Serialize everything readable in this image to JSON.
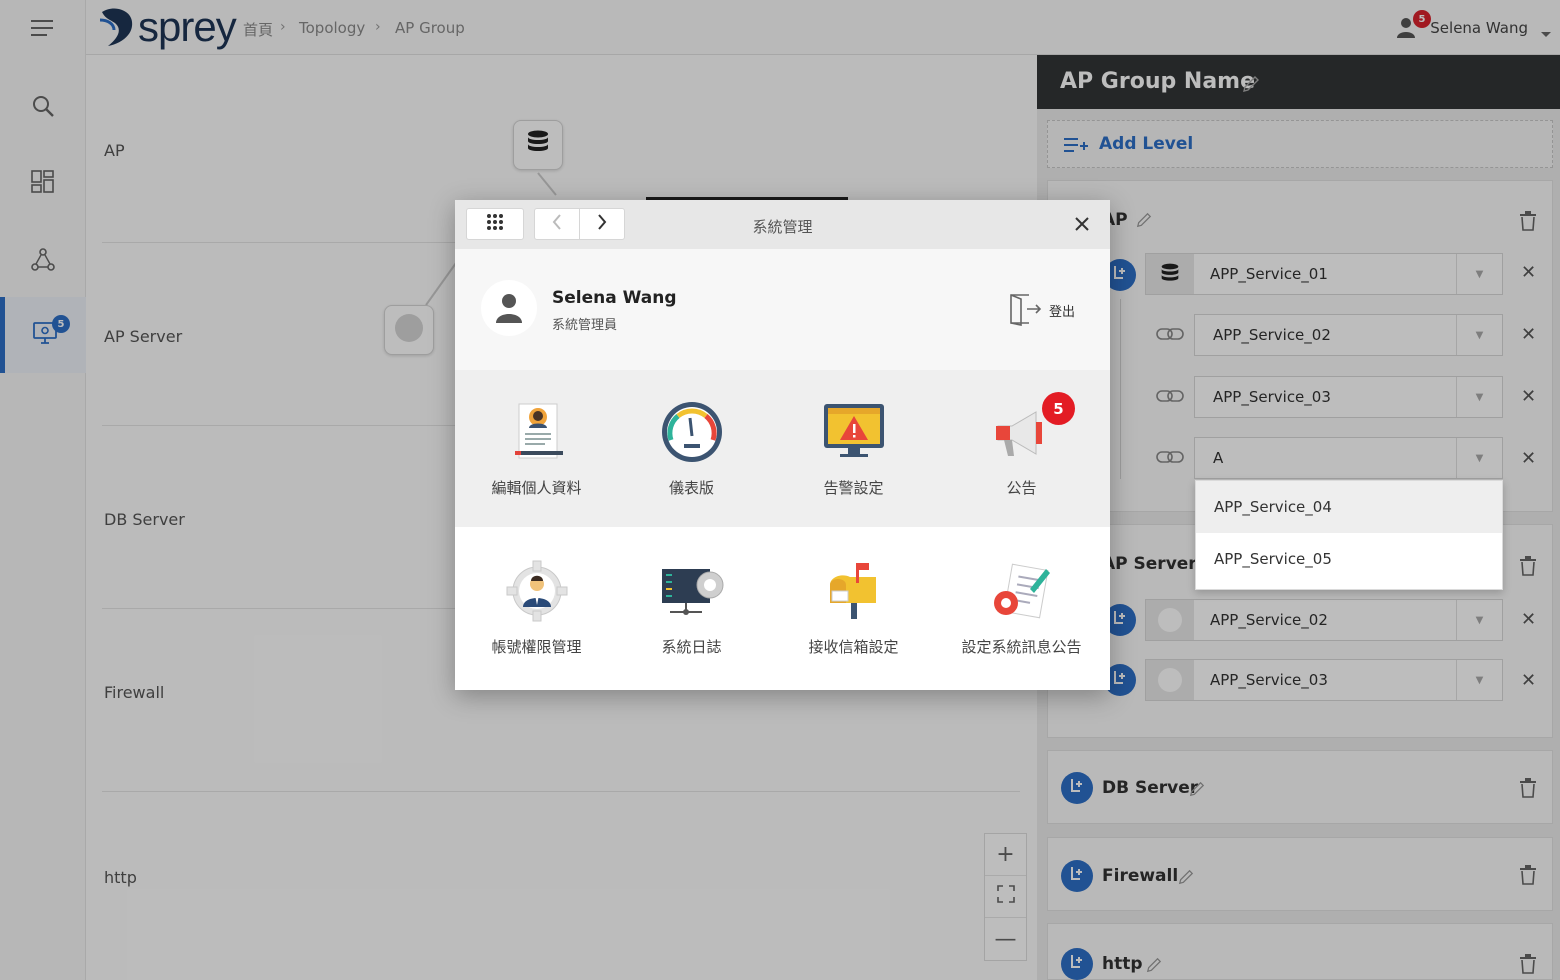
{
  "header": {
    "logo": "sprey",
    "breadcrumb": [
      "首頁",
      "Topology",
      "AP Group"
    ],
    "user_name": "Selena Wang",
    "notification_count": "5"
  },
  "sidebar": {
    "items": [
      {
        "icon": "menu-icon"
      },
      {
        "icon": "search-icon"
      },
      {
        "icon": "dashboard-icon"
      },
      {
        "icon": "topology-icon"
      },
      {
        "icon": "monitor-icon",
        "badge": "5",
        "active": true
      }
    ]
  },
  "canvas": {
    "rows": [
      "AP",
      "AP Server",
      "DB Server",
      "Firewall",
      "http"
    ]
  },
  "panel": {
    "title": "AP Group Name",
    "add_level": "Add Level",
    "levels": [
      {
        "name": "AP",
        "services": [
          "APP_Service_01",
          "APP_Service_02",
          "APP_Service_03",
          "A"
        ],
        "dropdown_options": [
          "APP_Service_04",
          "APP_Service_05"
        ]
      },
      {
        "name": "AP Server",
        "services": [
          "APP_Service_02",
          "APP_Service_03"
        ]
      },
      {
        "name": "DB Server"
      },
      {
        "name": "Firewall"
      },
      {
        "name": "http"
      }
    ]
  },
  "modal": {
    "title": "系統管理",
    "user": {
      "name": "Selena Wang",
      "role": "系統管理員"
    },
    "logout_label": "登出",
    "tiles": [
      {
        "label": "編輯個人資料",
        "icon": "profile-icon"
      },
      {
        "label": "儀表版",
        "icon": "gauge-icon"
      },
      {
        "label": "告警設定",
        "icon": "alert-icon"
      },
      {
        "label": "公告",
        "icon": "megaphone-icon",
        "badge": "5"
      },
      {
        "label": "帳號權限管理",
        "icon": "account-gear-icon"
      },
      {
        "label": "系統日誌",
        "icon": "server-log-icon"
      },
      {
        "label": "接收信箱設定",
        "icon": "mailbox-icon"
      },
      {
        "label": "設定系統訊息公告",
        "icon": "document-gear-icon"
      }
    ]
  }
}
